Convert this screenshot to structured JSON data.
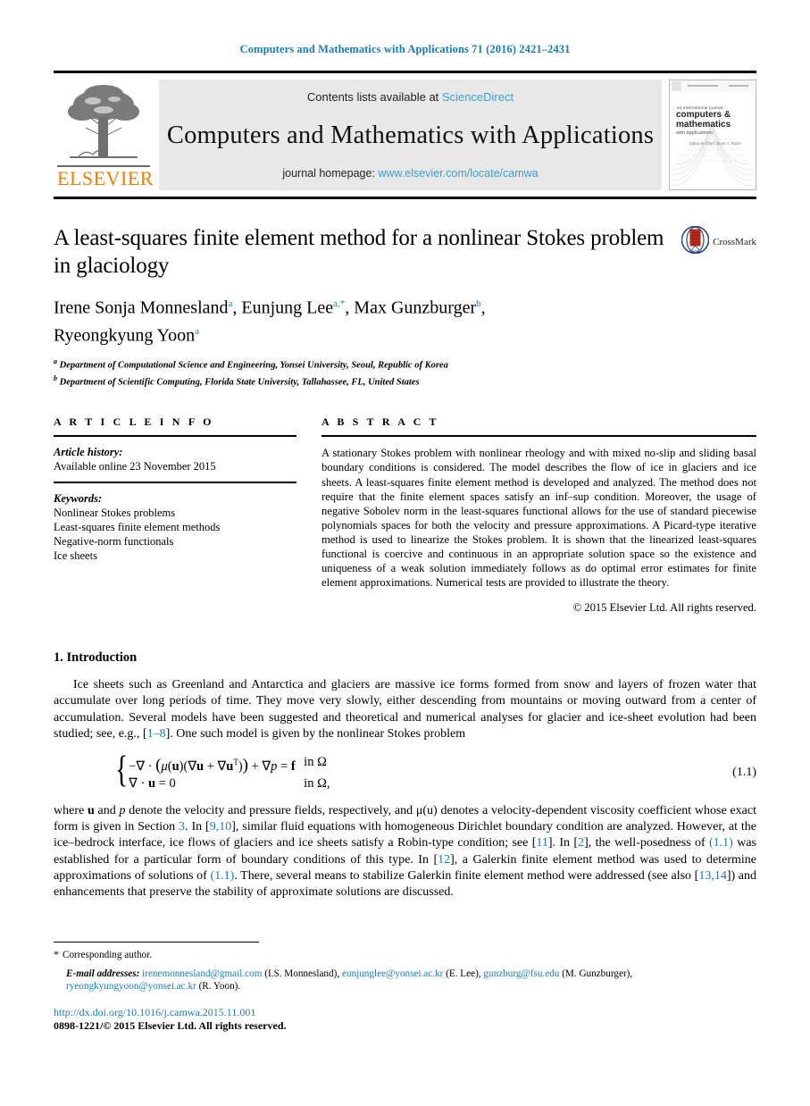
{
  "running_head": "Computers and Mathematics with Applications 71 (2016) 2421–2431",
  "masthead": {
    "publisher_word": "ELSEVIER",
    "publisher_logo": "elsevier-tree-logo",
    "contents_prefix": "Contents lists available at ",
    "contents_link": "ScienceDirect",
    "journal_name": "Computers and Mathematics with Applications",
    "homepage_prefix": "journal homepage: ",
    "homepage_link": "www.elsevier.com/locate/camwa",
    "cover": {
      "line1": "an international journal",
      "line2": "computers &",
      "line3": "mathematics",
      "line4": "with applications",
      "editor": "Editor-in-Chief: Ervin Y. Rodin"
    }
  },
  "article": {
    "title": "A least-squares finite element method for a nonlinear Stokes problem in glaciology",
    "crossmark_label": "CrossMark",
    "authors_line1": "Irene Sonja Monnesland",
    "authors_line1_sup": "a",
    "author2": "Eunjung Lee",
    "author2_sup": "a,*",
    "author3": "Max Gunzburger",
    "author3_sup": "b",
    "author4": "Ryeongkyung Yoon",
    "author4_sup": "a",
    "affiliations": [
      {
        "marker": "a",
        "text": "Department of Computational Science and Engineering, Yonsei University, Seoul, Republic of Korea"
      },
      {
        "marker": "b",
        "text": "Department of Scientific Computing, Florida State University, Tallahassee, FL, United States"
      }
    ]
  },
  "article_info": {
    "heading": "A R T I C L E   I N F O",
    "history_label": "Article history:",
    "history_value": "Available online 23 November 2015",
    "keywords_label": "Keywords:",
    "keywords": [
      "Nonlinear Stokes problems",
      "Least-squares finite element methods",
      "Negative-norm functionals",
      "Ice sheets"
    ]
  },
  "abstract": {
    "heading": "A B S T R A C T",
    "text": "A stationary Stokes problem with nonlinear rheology and with mixed no-slip and sliding basal boundary conditions is considered. The model describes the flow of ice in glaciers and ice sheets. A least-squares finite element method is developed and analyzed. The method does not require that the finite element spaces satisfy an inf–sup condition. Moreover, the usage of negative Sobolev norm in the least-squares functional allows for the use of standard piecewise polynomials spaces for both the velocity and pressure approximations. A Picard-type iterative method is used to linearize the Stokes problem. It is shown that the linearized least-squares functional is coercive and continuous in an appropriate solution space so the existence and uniqueness of a weak solution immediately follows as do optimal error estimates for finite element approximations. Numerical tests are provided to illustrate the theory.",
    "copyright": "© 2015 Elsevier Ltd. All rights reserved."
  },
  "introduction": {
    "heading": "1. Introduction",
    "para1_a": "Ice sheets such as Greenland and Antarctica and glaciers are massive ice forms formed from snow and layers of frozen water that accumulate over long periods of time. They move very slowly, either descending from mountains or moving outward from a center of accumulation. Several models have been suggested and theoretical and numerical analyses for glacier and ice-sheet evolution had been studied; see, e.g., ",
    "para1_ref": "1–8",
    "para1_b": "]. One such model is given by the nonlinear Stokes problem",
    "equation": {
      "line1_lhs": "−∇ · ( μ(u)(∇u + ∇u",
      "line1_sup": "T",
      "line1_lhs_end": ")) + ∇p = f",
      "line1_domain": "in Ω",
      "line2_lhs": "∇ · u = 0",
      "line2_domain": "in Ω,",
      "number": "(1.1)"
    },
    "para2_a": "where ",
    "para2_b": "u",
    "para2_c": " and ",
    "para2_d": "p",
    "para2_e": " denote the velocity and pressure fields, respectively, and μ(u) denotes a velocity-dependent viscosity coefficient whose exact form is given in Section ",
    "ref_section3": "3",
    "para2_f": ". In [",
    "ref_910": "9,10",
    "para2_g": "], similar fluid equations with homogeneous Dirichlet boundary condition are analyzed. However, at the ice–bedrock interface, ice flows of glaciers and ice sheets satisfy a Robin-type condition; see [",
    "ref_11": "11",
    "para2_h": "]. In [",
    "ref_2": "2",
    "para2_i": "], the well-posedness of ",
    "ref_eq11_a": "(1.1)",
    "para2_j": " was established for a particular form of boundary conditions of this type. In [",
    "ref_12": "12",
    "para2_k": "], a Galerkin finite element method was used to determine approximations of solutions of ",
    "ref_eq11_b": "(1.1)",
    "para2_l": ". There, several means to stabilize Galerkin finite element method were addressed (see also [",
    "ref_1314": "13,14",
    "para2_m": "]) and enhancements that preserve the stability of approximate solutions are discussed."
  },
  "footnotes": {
    "star": "*",
    "corresponding": "Corresponding author.",
    "email_label": "E-mail addresses:",
    "emails": [
      {
        "address": "irenemonnesland@gmail.com",
        "name": "(I.S. Monnesland),"
      },
      {
        "address": "eunjunglee@yonsei.ac.kr",
        "name": "(E. Lee),"
      },
      {
        "address": "gunzburg@fsu.edu",
        "name": "(M. Gunzburger),"
      },
      {
        "address": "ryeongkyungyoon@yonsei.ac.kr",
        "name": "(R. Yoon)."
      }
    ],
    "doi": "http://dx.doi.org/10.1016/j.camwa.2015.11.001",
    "issn": "0898-1221/© 2015 Elsevier Ltd. All rights reserved."
  },
  "colors": {
    "link_blue": "#1a7bb9",
    "sciencedirect_blue": "#3aa0d1",
    "elsevier_orange": "#f07d00",
    "band_grey": "#e8e8e8"
  }
}
